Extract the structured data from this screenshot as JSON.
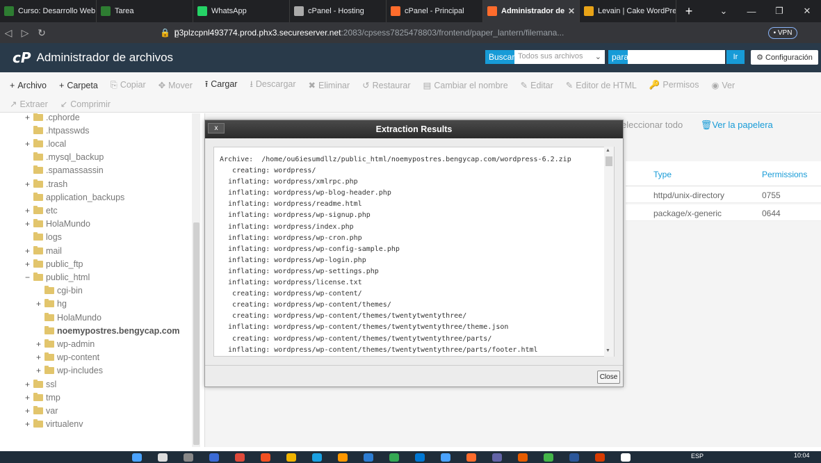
{
  "browser": {
    "tabs": [
      {
        "label": "Curso: Desarrollo Web",
        "fav_color": "#2e7d32"
      },
      {
        "label": "Tarea",
        "fav_color": "#2e7d32"
      },
      {
        "label": "WhatsApp",
        "fav_color": "#25d366"
      },
      {
        "label": "cPanel - Hosting",
        "fav_color": "#aaaaaa"
      },
      {
        "label": "cPanel - Principal",
        "fav_color": "#ff6c2c"
      },
      {
        "label": "Administrador de",
        "fav_color": "#ff6c2c"
      },
      {
        "label": "Levain | Cake WordPre",
        "fav_color": "#e8a317"
      }
    ],
    "url_host": "p3plzcpnl493774.prod.phx3.secureserver.net",
    "url_path": ":2083/cpsess7825478803/frontend/paper_lantern/filemana...",
    "vpn_label": "• VPN"
  },
  "header": {
    "logo": "cP",
    "title": "Administrador de archivos",
    "search_label": "Buscar",
    "search_select": "Todos sus archivos",
    "para_label": "para",
    "go_label": "Ir",
    "config_label": "Configuración"
  },
  "toolbar": {
    "row1": [
      {
        "icon": "+",
        "label": "Archivo",
        "enabled": true
      },
      {
        "icon": "+",
        "label": "Carpeta",
        "enabled": true
      },
      {
        "icon": "⎘",
        "label": "Copiar",
        "enabled": false
      },
      {
        "icon": "✥",
        "label": "Mover",
        "enabled": false
      },
      {
        "icon": "⭱",
        "label": "Cargar",
        "enabled": true
      },
      {
        "icon": "⭳",
        "label": "Descargar",
        "enabled": false
      },
      {
        "icon": "✖",
        "label": "Eliminar",
        "enabled": false
      },
      {
        "icon": "↺",
        "label": "Restaurar",
        "enabled": false
      },
      {
        "icon": "▤",
        "label": "Cambiar el nombre",
        "enabled": false
      },
      {
        "icon": "✎",
        "label": "Editar",
        "enabled": false
      },
      {
        "icon": "✎",
        "label": "Editor de HTML",
        "enabled": false
      },
      {
        "icon": "🔑",
        "label": "Permisos",
        "enabled": false
      },
      {
        "icon": "◉",
        "label": "Ver",
        "enabled": false
      }
    ],
    "row2": [
      {
        "icon": "↗",
        "label": "Extraer",
        "enabled": false
      },
      {
        "icon": "↙",
        "label": "Comprimir",
        "enabled": false
      }
    ]
  },
  "tree": [
    {
      "label": ".cphorde",
      "exp": "+",
      "indent": 0
    },
    {
      "label": ".htpasswds",
      "exp": "",
      "indent": 0
    },
    {
      "label": ".local",
      "exp": "+",
      "indent": 0
    },
    {
      "label": ".mysql_backup",
      "exp": "",
      "indent": 0
    },
    {
      "label": ".spamassassin",
      "exp": "",
      "indent": 0
    },
    {
      "label": ".trash",
      "exp": "+",
      "indent": 0
    },
    {
      "label": "application_backups",
      "exp": "",
      "indent": 0
    },
    {
      "label": "etc",
      "exp": "+",
      "indent": 0
    },
    {
      "label": "HolaMundo",
      "exp": "+",
      "indent": 0
    },
    {
      "label": "logs",
      "exp": "",
      "indent": 0
    },
    {
      "label": "mail",
      "exp": "+",
      "indent": 0
    },
    {
      "label": "public_ftp",
      "exp": "+",
      "indent": 0
    },
    {
      "label": "public_html",
      "exp": "−",
      "indent": 0
    },
    {
      "label": "cgi-bin",
      "exp": "",
      "indent": 1
    },
    {
      "label": "hg",
      "exp": "+",
      "indent": 1
    },
    {
      "label": "HolaMundo",
      "exp": "",
      "indent": 1
    },
    {
      "label": "noemypostres.bengycap.com",
      "exp": "",
      "indent": 1,
      "bold": true
    },
    {
      "label": "wp-admin",
      "exp": "+",
      "indent": 1
    },
    {
      "label": "wp-content",
      "exp": "+",
      "indent": 1
    },
    {
      "label": "wp-includes",
      "exp": "+",
      "indent": 1
    },
    {
      "label": "ssl",
      "exp": "+",
      "indent": 0
    },
    {
      "label": "tmp",
      "exp": "+",
      "indent": 0
    },
    {
      "label": "var",
      "exp": "+",
      "indent": 0
    },
    {
      "label": "virtualenv",
      "exp": "+",
      "indent": 0
    }
  ],
  "right": {
    "select_all": "eleccionar todo",
    "trash_link": "Ver la papelera",
    "col_type": "Type",
    "col_perm": "Permissions",
    "rows": [
      {
        "type": "httpd/unix-directory",
        "perm": "0755"
      },
      {
        "type": "package/x-generic",
        "perm": "0644"
      }
    ]
  },
  "dialog": {
    "title": "Extraction Results",
    "close_x": "x",
    "close_label": "Close",
    "lines": [
      "Archive:  /home/ou6iesumdllz/public_html/noemypostres.bengycap.com/wordpress-6.2.zip",
      "   creating: wordpress/",
      "  inflating: wordpress/xmlrpc.php",
      "  inflating: wordpress/wp-blog-header.php",
      "  inflating: wordpress/readme.html",
      "  inflating: wordpress/wp-signup.php",
      "  inflating: wordpress/index.php",
      "  inflating: wordpress/wp-cron.php",
      "  inflating: wordpress/wp-config-sample.php",
      "  inflating: wordpress/wp-login.php",
      "  inflating: wordpress/wp-settings.php",
      "  inflating: wordpress/license.txt",
      "   creating: wordpress/wp-content/",
      "   creating: wordpress/wp-content/themes/",
      "   creating: wordpress/wp-content/themes/twentytwentythree/",
      "  inflating: wordpress/wp-content/themes/twentytwentythree/theme.json",
      "   creating: wordpress/wp-content/themes/twentytwentythree/parts/",
      "  inflating: wordpress/wp-content/themes/twentytwentythree/parts/footer.html"
    ]
  },
  "taskbar": {
    "lang": "ESP",
    "time": "10:04"
  }
}
